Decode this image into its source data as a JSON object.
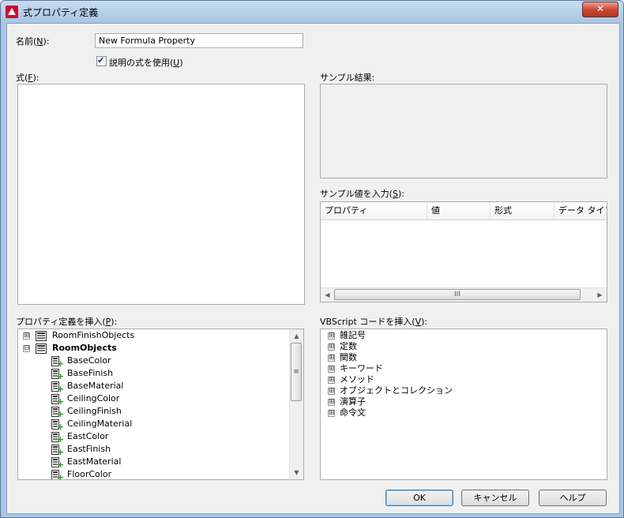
{
  "window": {
    "title": "式プロパティ定義",
    "close_label": "✕"
  },
  "name_field": {
    "label": "名前(",
    "label_key": "N",
    "label_end": "):",
    "value": "New Formula Property"
  },
  "use_description": {
    "checked": true,
    "label": "説明の式を使用(",
    "label_key": "U",
    "label_end": ")"
  },
  "formula": {
    "label": "式(",
    "label_key": "F",
    "label_end": "):",
    "value": ""
  },
  "sample_result": {
    "label": "サンプル結果:"
  },
  "sample_values": {
    "label": "サンプル値を入力(",
    "label_key": "S",
    "label_end": "):",
    "columns": [
      "プロパティ",
      "値",
      "形式",
      "データ タイプ"
    ],
    "scroll_thumb": "III"
  },
  "insert_property": {
    "label": "プロパティ定義を挿入(",
    "label_key": "P",
    "label_end": "):",
    "nodes": [
      {
        "label": "RoomFinishObjects",
        "kind": "group",
        "expanded": false
      },
      {
        "label": "RoomObjects",
        "kind": "group",
        "expanded": true,
        "bold": true
      },
      {
        "label": "BaseColor",
        "kind": "property"
      },
      {
        "label": "BaseFinish",
        "kind": "property"
      },
      {
        "label": "BaseMaterial",
        "kind": "property"
      },
      {
        "label": "CeilingColor",
        "kind": "property"
      },
      {
        "label": "CeilingFinish",
        "kind": "property"
      },
      {
        "label": "CeilingMaterial",
        "kind": "property"
      },
      {
        "label": "EastColor",
        "kind": "property"
      },
      {
        "label": "EastFinish",
        "kind": "property"
      },
      {
        "label": "EastMaterial",
        "kind": "property"
      },
      {
        "label": "FloorColor",
        "kind": "property"
      }
    ],
    "scroll_thumb": "≡"
  },
  "insert_vbscript": {
    "label": "VBScript コードを挿入(",
    "label_key": "V",
    "label_end": "):",
    "nodes": [
      "雑記号",
      "定数",
      "関数",
      "キーワード",
      "メソッド",
      "オブジェクトとコレクション",
      "演算子",
      "命令文"
    ]
  },
  "buttons": {
    "ok": "OK",
    "cancel": "キャンセル",
    "help": "ヘルプ"
  },
  "icons": {
    "expand": "⊞",
    "collapse": "⊟",
    "left_arrow": "◀",
    "right_arrow": "▶",
    "up_arrow": "▲",
    "down_arrow": "▼"
  },
  "colors": {
    "titlebar": "#a9c6e6",
    "close_button": "#c74b3a",
    "dialog_bg": "#f0f0f0",
    "add_icon": "#1e9a1e"
  }
}
